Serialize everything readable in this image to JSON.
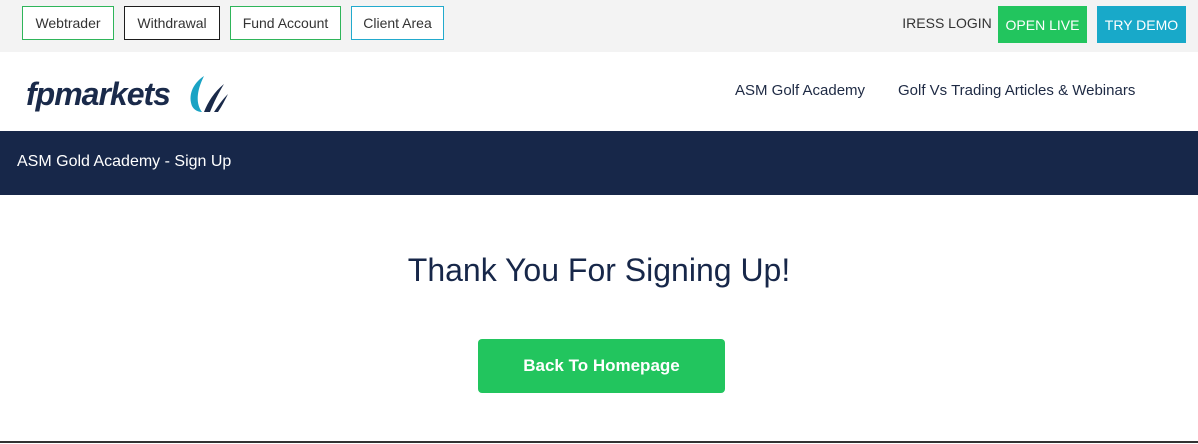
{
  "topbar": {
    "buttons": [
      {
        "label": "Webtrader"
      },
      {
        "label": "Withdrawal"
      },
      {
        "label": "Fund Account"
      },
      {
        "label": "Client Area"
      }
    ],
    "iress_login": "IRESS LOGIN",
    "open_live": "OPEN LIVE",
    "try_demo": "TRY DEMO"
  },
  "header": {
    "logo_text": "fpmarkets",
    "nav": [
      {
        "label": "ASM Golf Academy"
      },
      {
        "label": "Golf Vs Trading Articles & Webinars"
      }
    ]
  },
  "titlebar": {
    "title": "ASM Gold Academy - Sign Up"
  },
  "main": {
    "heading": "Thank You For Signing Up!",
    "back_button": "Back To Homepage"
  },
  "colors": {
    "navy": "#172749",
    "green": "#22c55e",
    "teal": "#18a9c9",
    "topbar_bg": "#f3f3f3"
  },
  "icons": {
    "logo_mark": "fp-swoosh-icon"
  }
}
